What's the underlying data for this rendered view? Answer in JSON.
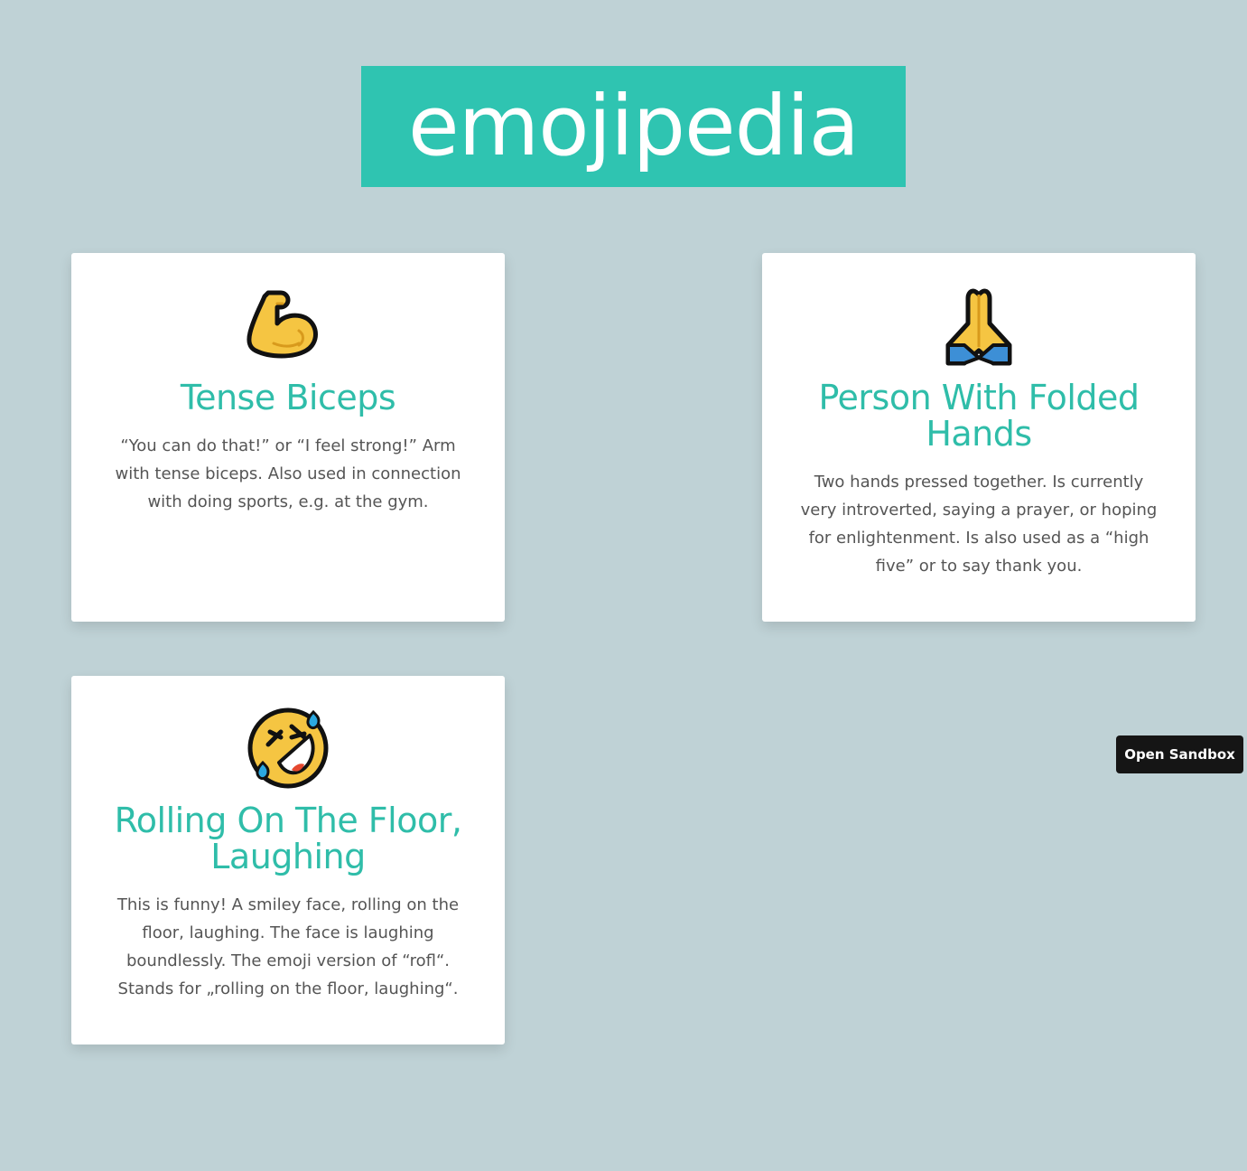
{
  "header": {
    "logo_text": "emojipedia"
  },
  "cards": [
    {
      "icon": "flexed-biceps-icon",
      "term": "Tense Biceps",
      "description": "“You can do that!” or “I feel strong!” Arm with tense biceps. Also used in connection with doing sports, e.g. at the gym."
    },
    {
      "icon": "folded-hands-icon",
      "term": "Person With Folded Hands",
      "description": "Two hands pressed together. Is currently very introverted, saying a prayer, or hoping for enlightenment. Is also used as a “high five” or to say thank you."
    },
    {
      "icon": "rolling-on-floor-laughing-icon",
      "term": "Rolling On The Floor, Laughing",
      "description": "This is funny! A smiley face, rolling on the floor, laughing. The face is laughing boundlessly. The emoji version of “rofl“. Stands for „rolling on the floor, laughing“."
    }
  ],
  "sandbox_button": {
    "label": "Open Sandbox"
  },
  "colors": {
    "background": "#bfd2d6",
    "accent": "#2fc4b1",
    "card": "#ffffff",
    "text": "#555555",
    "button": "#151515"
  }
}
